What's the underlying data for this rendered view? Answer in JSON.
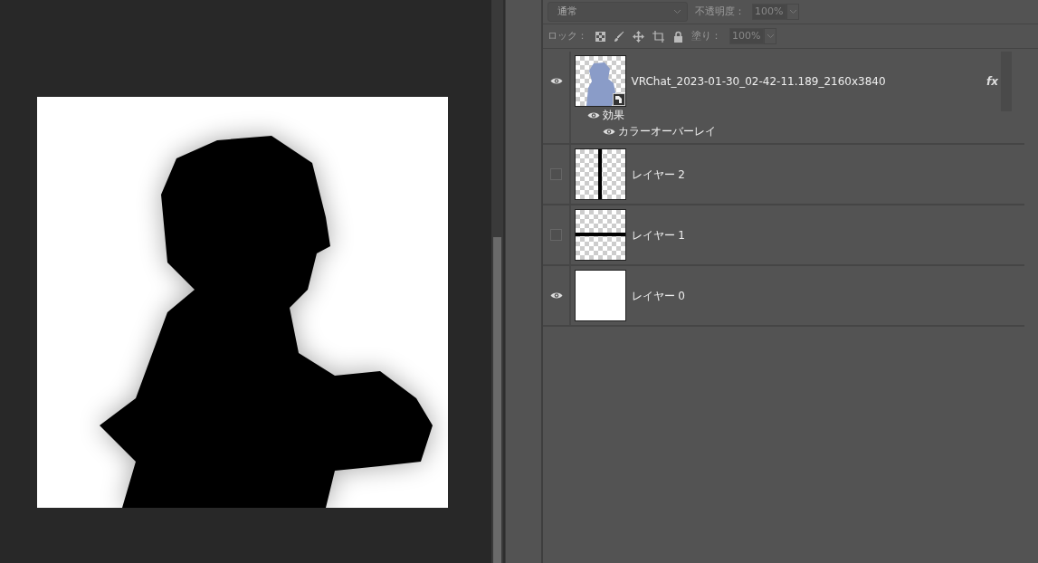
{
  "blend_mode": {
    "value": "通常"
  },
  "opacity": {
    "label": "不透明度：",
    "value": "100%"
  },
  "lock": {
    "label": "ロック："
  },
  "fill": {
    "label": "塗り：",
    "value": "100%"
  },
  "layers": [
    {
      "name": "VRChat_2023-01-30_02-42-11.189_2160x3840",
      "visible": true,
      "kind": "smart",
      "fx": "fx",
      "effects_label": "効果",
      "effects_visible": true,
      "effects": [
        {
          "name": "カラーオーバーレイ",
          "visible": true
        }
      ]
    },
    {
      "name": "レイヤー 2",
      "visible": false,
      "kind": "vline"
    },
    {
      "name": "レイヤー 1",
      "visible": false,
      "kind": "hline"
    },
    {
      "name": "レイヤー 0",
      "visible": true,
      "kind": "white"
    }
  ]
}
